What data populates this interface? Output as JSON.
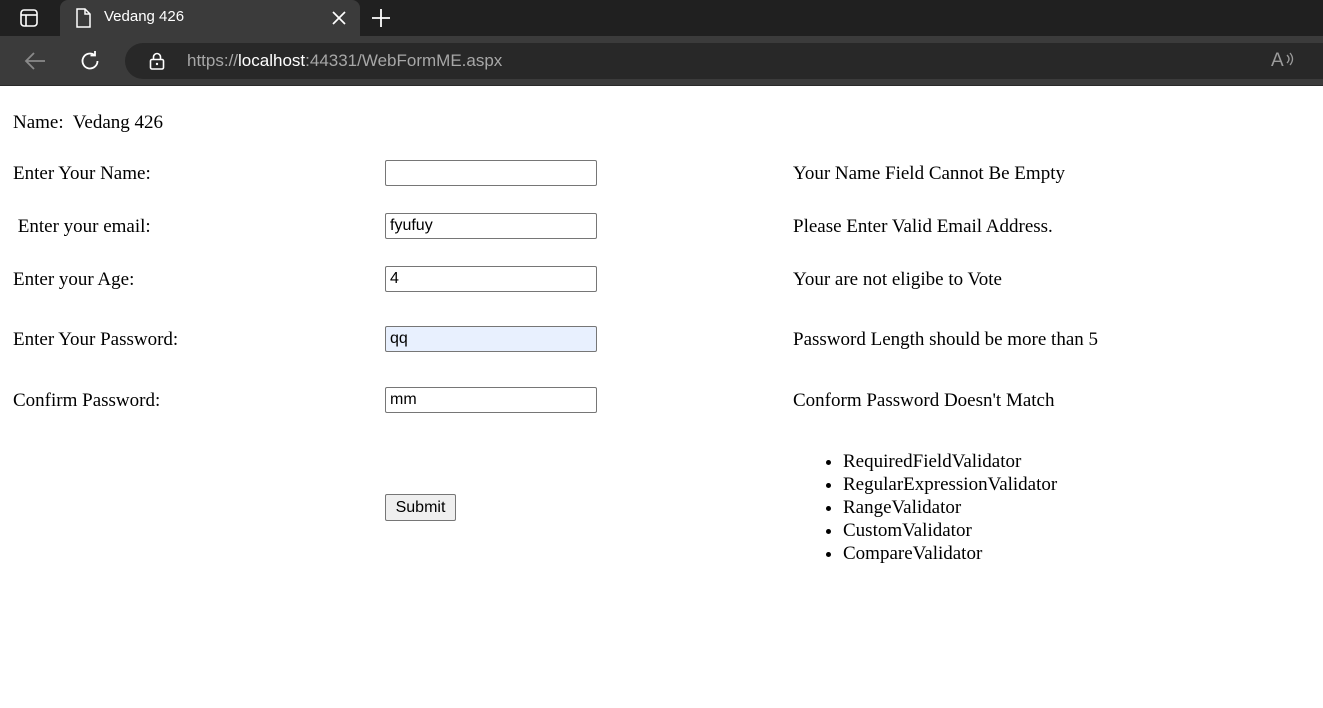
{
  "browser": {
    "tab_title": "Vedang 426",
    "url_scheme": "https://",
    "url_host": "localhost",
    "url_rest": ":44331/WebFormME.aspx",
    "read_aloud_label": "A"
  },
  "page": {
    "name_label": "Name:  Vedang 426",
    "fields": [
      {
        "label": "Enter Your Name:",
        "value": "",
        "error": "Your Name Field Cannot Be Empty"
      },
      {
        "label": " Enter your email:",
        "value": "fyufuy",
        "error": "Please Enter Valid Email Address."
      },
      {
        "label": "Enter your Age:",
        "value": "4",
        "error": "Your are not eligibe to Vote"
      },
      {
        "label": "Enter Your Password:",
        "value": "qq",
        "error": "Password Length should be more than 5"
      },
      {
        "label": "Confirm Password:",
        "value": "mm",
        "error": "Conform Password Doesn't Match"
      }
    ],
    "submit_label": "Submit",
    "validators": [
      "RequiredFieldValidator",
      "RegularExpressionValidator",
      "RangeValidator",
      "CustomValidator",
      "CompareValidator"
    ]
  },
  "colors": {
    "tabbar_bg": "#202020",
    "toolbar_bg": "#3b3b3b",
    "autofill_bg": "#e8f0fe"
  }
}
